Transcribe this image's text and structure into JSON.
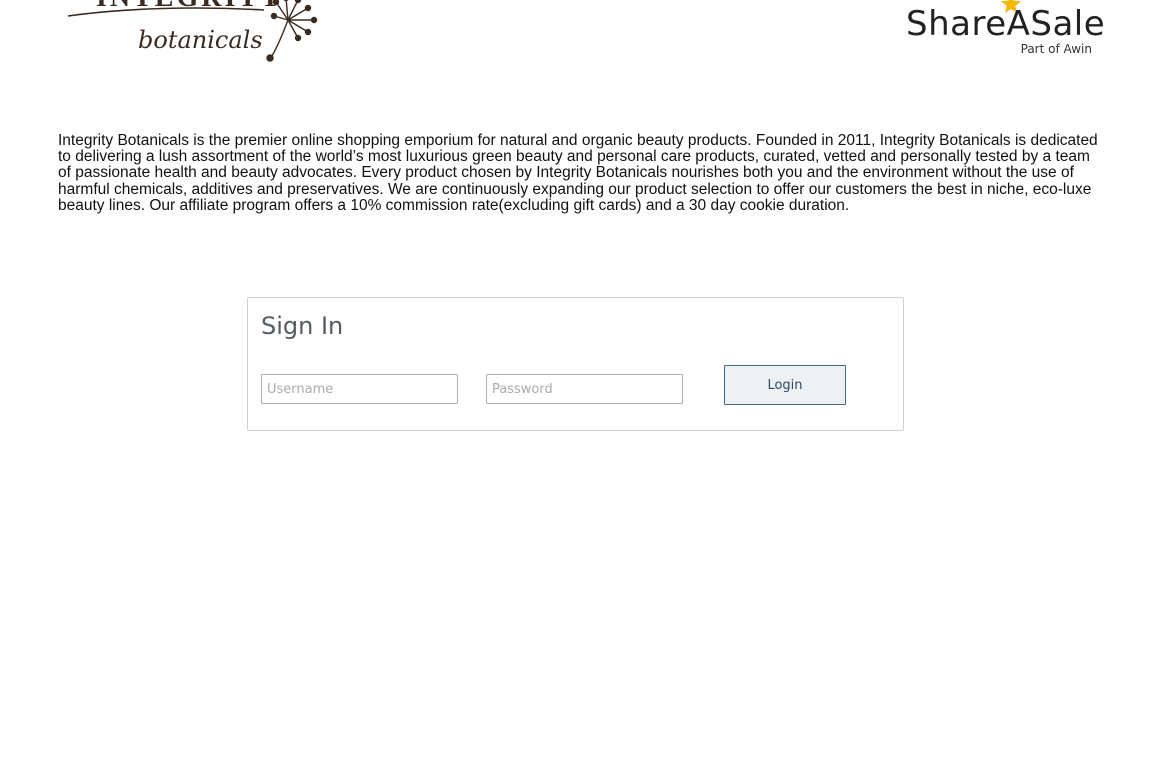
{
  "header": {
    "brand_logo": {
      "wordmark": "INTEGRITY",
      "script": "botanicals",
      "icon": "dandelion-flower-icon",
      "color": "#3b2a1f"
    },
    "network_logo": {
      "name": "ShareASale",
      "tagline": "Part of Awin",
      "icon": "star-icon",
      "star_color": "#f5b800"
    }
  },
  "description": "Integrity Botanicals is the premier online shopping emporium for natural and organic beauty products. Founded in 2011, Integrity Botanicals is dedicated to delivering a lush assortment of the world’s most luxurious green beauty and personal care products, curated, vetted and personally tested by a team of passionate health and beauty advocates. Every product chosen by Integrity Botanicals nourishes both you and the environment without the use of harmful chemicals, additives and preservatives. We are continuously expanding our product selection to offer our customers the best in niche, eco-luxe beauty lines. Our affiliate program offers a 10% commission rate(excluding gift cards) and a 30 day cookie duration.",
  "signin": {
    "title": "Sign In",
    "username": {
      "placeholder": "Username",
      "value": ""
    },
    "password": {
      "placeholder": "Password",
      "value": ""
    },
    "login_label": "Login"
  }
}
